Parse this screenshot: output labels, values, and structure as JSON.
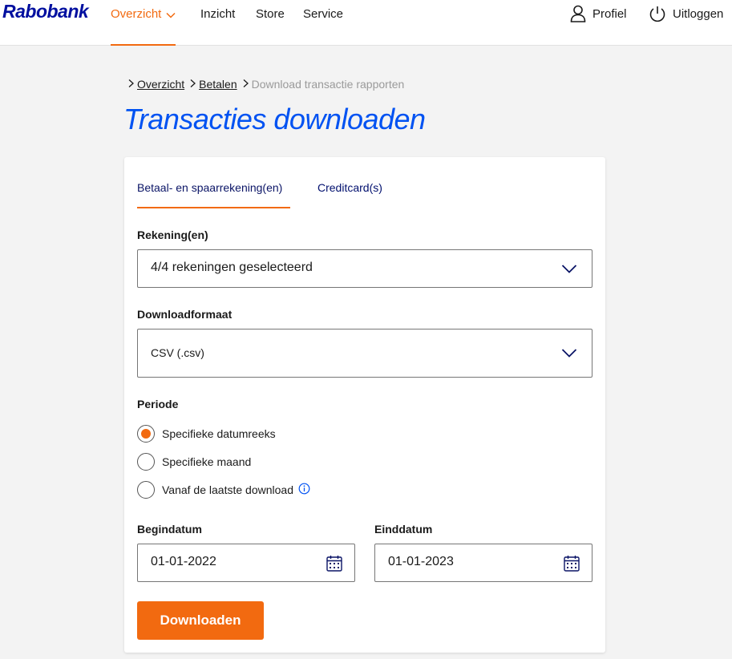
{
  "header": {
    "logo": "Rabobank",
    "nav": [
      {
        "label": "Overzicht",
        "active": true,
        "has_dropdown": true
      },
      {
        "label": "Inzicht"
      },
      {
        "label": "Store"
      },
      {
        "label": "Service"
      }
    ],
    "profile_label": "Profiel",
    "logout_label": "Uitloggen"
  },
  "breadcrumb": {
    "items": [
      "Overzicht",
      "Betalen"
    ],
    "current": "Download transactie rapporten"
  },
  "page": {
    "title": "Transacties downloaden"
  },
  "tabs": [
    {
      "label": "Betaal- en spaarrekening(en)",
      "active": true
    },
    {
      "label": "Creditcard(s)",
      "active": false
    }
  ],
  "form": {
    "accounts": {
      "label": "Rekening(en)",
      "value": "4/4 rekeningen geselecteerd"
    },
    "format": {
      "label": "Downloadformaat",
      "value": "CSV (.csv)"
    },
    "period": {
      "label": "Periode",
      "options": [
        {
          "label": "Specifieke datumreeks",
          "checked": true
        },
        {
          "label": "Specifieke maand",
          "checked": false
        },
        {
          "label": "Vanaf de laatste download",
          "checked": false,
          "info_icon": "info-icon"
        }
      ]
    },
    "start_date": {
      "label": "Begindatum",
      "value": "01-01-2022"
    },
    "end_date": {
      "label": "Einddatum",
      "value": "01-01-2023"
    },
    "submit_label": "Downloaden"
  },
  "colors": {
    "brand_blue": "#000f9f",
    "title_blue": "#0052f2",
    "accent_orange": "#f26a10"
  }
}
